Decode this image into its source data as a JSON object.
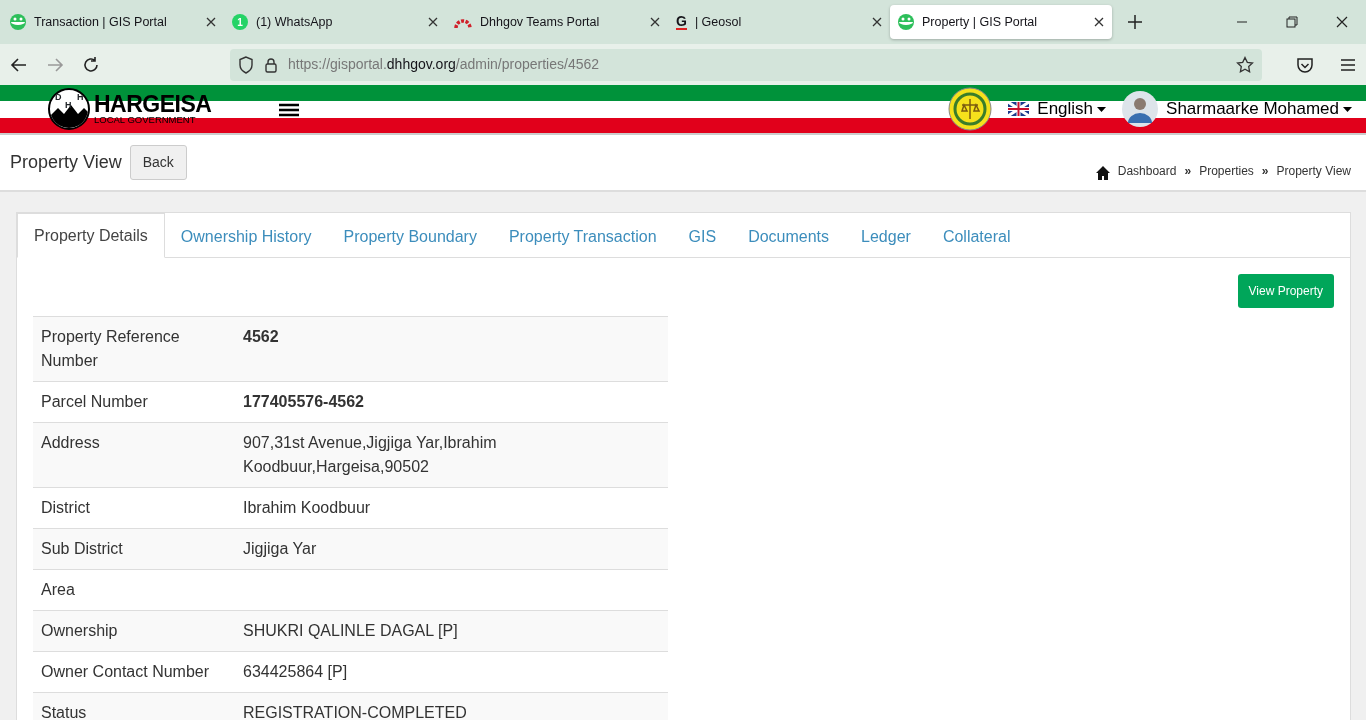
{
  "browser_tabs": [
    {
      "title": "Transaction | GIS Portal",
      "kind": "portal",
      "selected": false
    },
    {
      "title": "(1) WhatsApp",
      "kind": "whatsapp",
      "selected": false
    },
    {
      "title": "Dhhgov Teams Portal",
      "kind": "teams",
      "selected": false
    },
    {
      "title": "| Geosol",
      "kind": "geosol",
      "selected": false
    },
    {
      "title": "Property | GIS Portal",
      "kind": "portal",
      "selected": true
    }
  ],
  "whatsapp_badge": "1",
  "geosol_letter": "G",
  "address_bar": {
    "prefix": "https://gisportal.",
    "domain": "dhhgov.org",
    "path": "/admin/properties/4562"
  },
  "site_header": {
    "logo_letters": [
      "D",
      "H",
      "H"
    ],
    "logo_title": "HARGEISA",
    "logo_subtitle": "LOCAL GOVERNMENT",
    "language": "English",
    "user": "Sharmaarke Mohamed"
  },
  "page": {
    "title": "Property View",
    "back": "Back",
    "breadcrumb": [
      "Dashboard",
      "Properties",
      "Property View"
    ],
    "separator": "»"
  },
  "tabs": [
    {
      "label": "Property Details",
      "selected": true
    },
    {
      "label": "Ownership History",
      "selected": false
    },
    {
      "label": "Property Boundary",
      "selected": false
    },
    {
      "label": "Property Transaction",
      "selected": false
    },
    {
      "label": "GIS",
      "selected": false
    },
    {
      "label": "Documents",
      "selected": false
    },
    {
      "label": "Ledger",
      "selected": false
    },
    {
      "label": "Collateral",
      "selected": false
    }
  ],
  "view_button": "View Property",
  "details": [
    {
      "label": "Property Reference Number",
      "value": "4562",
      "bold": true
    },
    {
      "label": "Parcel Number",
      "value": "177405576-4562",
      "bold": true
    },
    {
      "label": "Address",
      "value": "907,31st Avenue,Jigjiga Yar,Ibrahim Koodbuur,Hargeisa,90502",
      "bold": false
    },
    {
      "label": "District",
      "value": "Ibrahim Koodbuur",
      "bold": false
    },
    {
      "label": "Sub District",
      "value": "Jigjiga Yar",
      "bold": false
    },
    {
      "label": "Area"
    },
    {
      "label": "Ownership",
      "value": "SHUKRI QALINLE DAGAL [P]",
      "bold": false
    },
    {
      "label": "Owner Contact Number",
      "value": "634425864 [P]",
      "bold": false
    },
    {
      "label": "Status",
      "value": "REGISTRATION-COMPLETED",
      "bold": false
    }
  ]
}
